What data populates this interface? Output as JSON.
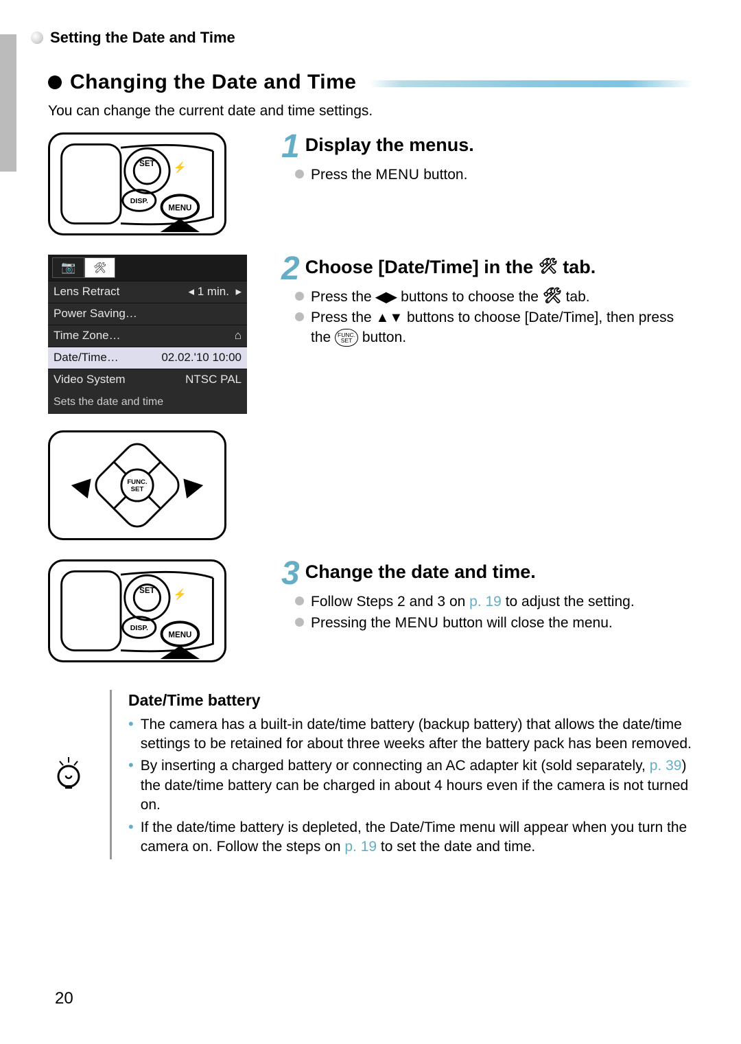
{
  "breadcrumb": "Setting the Date and Time",
  "section_title": "Changing the Date and Time",
  "intro": "You can change the current date and time settings.",
  "steps": [
    {
      "num": "1",
      "title": "Display the menus.",
      "bullets": [
        {
          "text_pre": "Press the ",
          "menu": "MENU",
          "text_post": " button."
        }
      ]
    },
    {
      "num": "2",
      "title_pre": "Choose [Date/Time] in the ",
      "title_post": " tab.",
      "bullets": [
        {
          "pre": "Press the ",
          "arrows": "◀▶",
          "mid": " buttons to choose the ",
          "post": " tab."
        },
        {
          "pre": "Press the ",
          "arrows": "▲▼",
          "mid": " buttons to choose [Date/Time], then press the ",
          "func": true,
          "post": " button."
        }
      ]
    },
    {
      "num": "3",
      "title": "Change the date and time.",
      "bullets": [
        {
          "pre": "Follow Steps 2 and 3 on ",
          "link": "p. 19",
          "post": " to adjust the setting."
        },
        {
          "pre": "Pressing the ",
          "menu": "MENU",
          "post": " button will close the menu."
        }
      ]
    }
  ],
  "menu_screenshot": {
    "tabs": [
      "📷",
      "🛠"
    ],
    "items": [
      {
        "label": "Lens Retract",
        "value": "◂ 1 min.",
        "arrow": "▸"
      },
      {
        "label": "Power Saving…",
        "value": ""
      },
      {
        "label": "Time Zone…",
        "value": "⌂"
      },
      {
        "label": "Date/Time…",
        "value": "02.02.'10 10:00",
        "selected": true
      },
      {
        "label": "Video System",
        "value": "NTSC  PAL"
      }
    ],
    "hint": "Sets the date and time"
  },
  "note": {
    "title": "Date/Time battery",
    "items": [
      "The camera has a built-in date/time battery (backup battery) that allows the date/time settings to be retained for about three weeks after the battery pack has been removed.",
      {
        "pre": "By inserting a charged battery or connecting an AC adapter kit (sold separately, ",
        "link": "p. 39",
        "post": ") the date/time battery can be charged in about 4 hours even if the camera is not turned on."
      },
      {
        "pre": "If the date/time battery is depleted, the Date/Time menu will appear when you turn the camera on. Follow the steps on ",
        "link": "p. 19",
        "post": " to set the date and time."
      }
    ]
  },
  "funcset_top": "FUNC.",
  "funcset_bot": "SET",
  "page_number": "20"
}
